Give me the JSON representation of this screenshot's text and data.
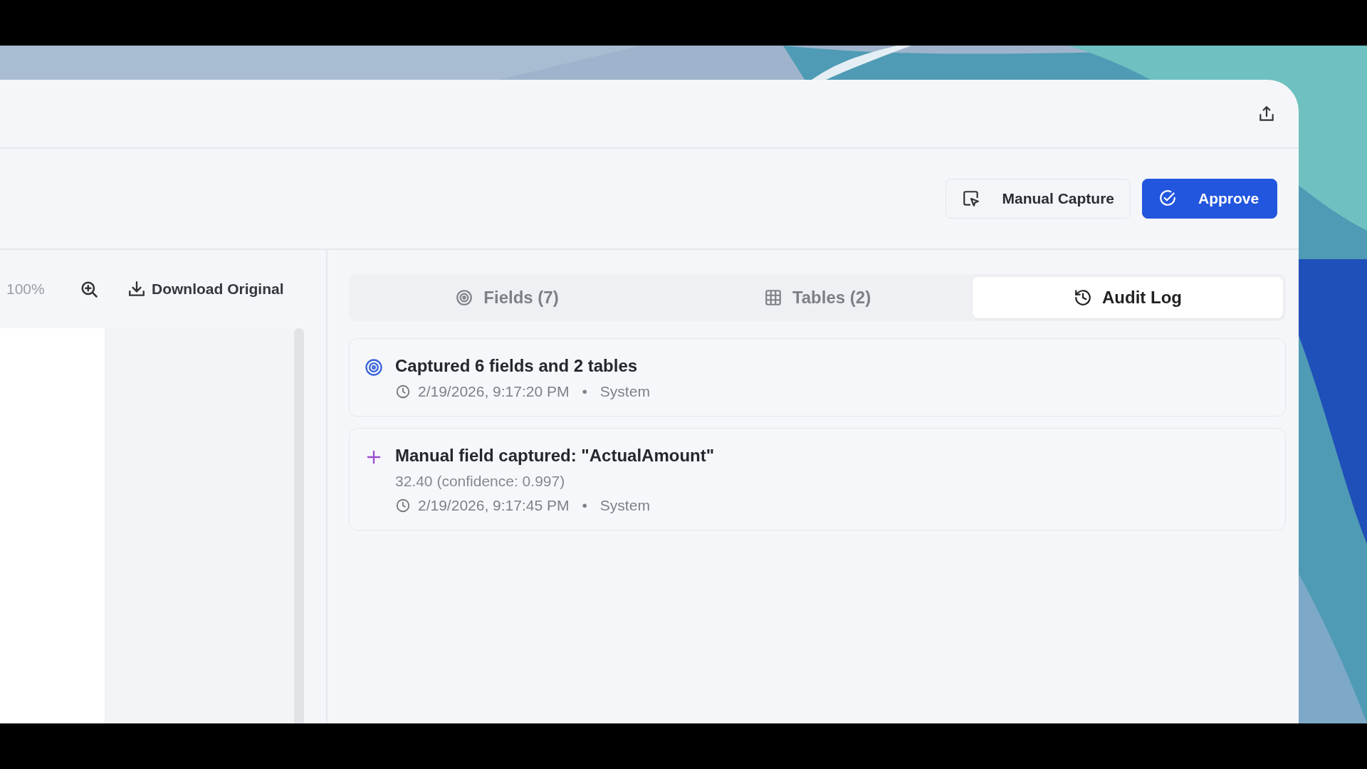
{
  "actions": [
    {
      "kind": "secondary",
      "label": "Manual Capture"
    },
    {
      "kind": "primary",
      "label": "Approve"
    }
  ],
  "viewer": {
    "zoom": "100%",
    "download": "Download Original"
  },
  "tabs": [
    {
      "kind": "fields",
      "label": "Fields (7)",
      "selected": false
    },
    {
      "kind": "tables",
      "label": "Tables (2)",
      "selected": false
    },
    {
      "kind": "audit",
      "label": "Audit Log",
      "selected": true
    }
  ],
  "audit_log": [
    {
      "kind": "capture",
      "title": "Captured 6 fields and 2 tables",
      "time": "2/19/2026, 9:17:20 PM",
      "separator": "•",
      "user": "System"
    },
    {
      "kind": "manual",
      "title": "Manual field captured: \"ActualAmount\"",
      "detail": "32.40 (confidence: 0.997)",
      "time": "2/19/2026, 9:17:45 PM",
      "separator": "•",
      "user": "System"
    }
  ]
}
